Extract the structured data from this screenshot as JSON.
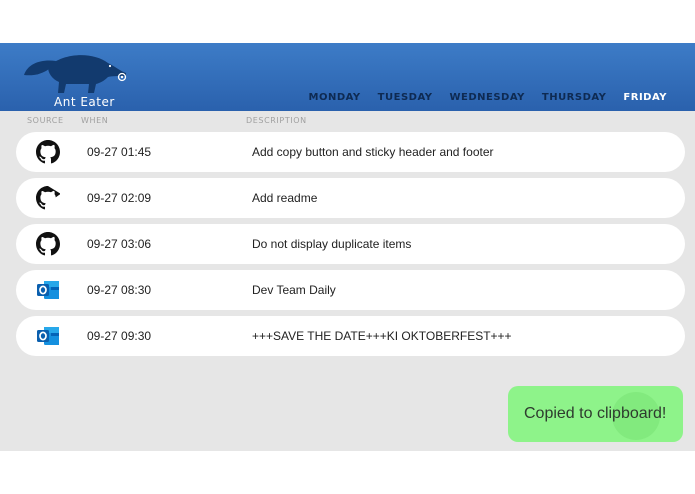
{
  "app": {
    "title": "Ant Eater"
  },
  "days": [
    "MONDAY",
    "TUESDAY",
    "WEDNESDAY",
    "THURSDAY",
    "FRIDAY"
  ],
  "active_day": "FRIDAY",
  "columns": {
    "source": "SOURCE",
    "when": "WHEN",
    "description": "DESCRIPTION"
  },
  "rows": [
    {
      "source_icon": "github-icon",
      "when": "09-27 01:45",
      "description": "Add copy button and sticky header and footer"
    },
    {
      "source_icon": "github-icon",
      "when": "09-27 02:09",
      "description": "Add readme"
    },
    {
      "source_icon": "github-icon",
      "when": "09-27 03:06",
      "description": "Do not display duplicate items"
    },
    {
      "source_icon": "outlook-icon",
      "when": "09-27 08:30",
      "description": "Dev Team Daily"
    },
    {
      "source_icon": "outlook-icon",
      "when": "09-27 09:30",
      "description": "+++SAVE THE DATE+++KI OKTOBERFEST+++"
    }
  ],
  "toast": {
    "text": "Copied to clipboard!"
  },
  "colors": {
    "header": "#2f6bb8",
    "active_day": "#ffffff",
    "day": "#0e2a52",
    "toast": "#8ef38a",
    "background": "#e6e6e6"
  }
}
